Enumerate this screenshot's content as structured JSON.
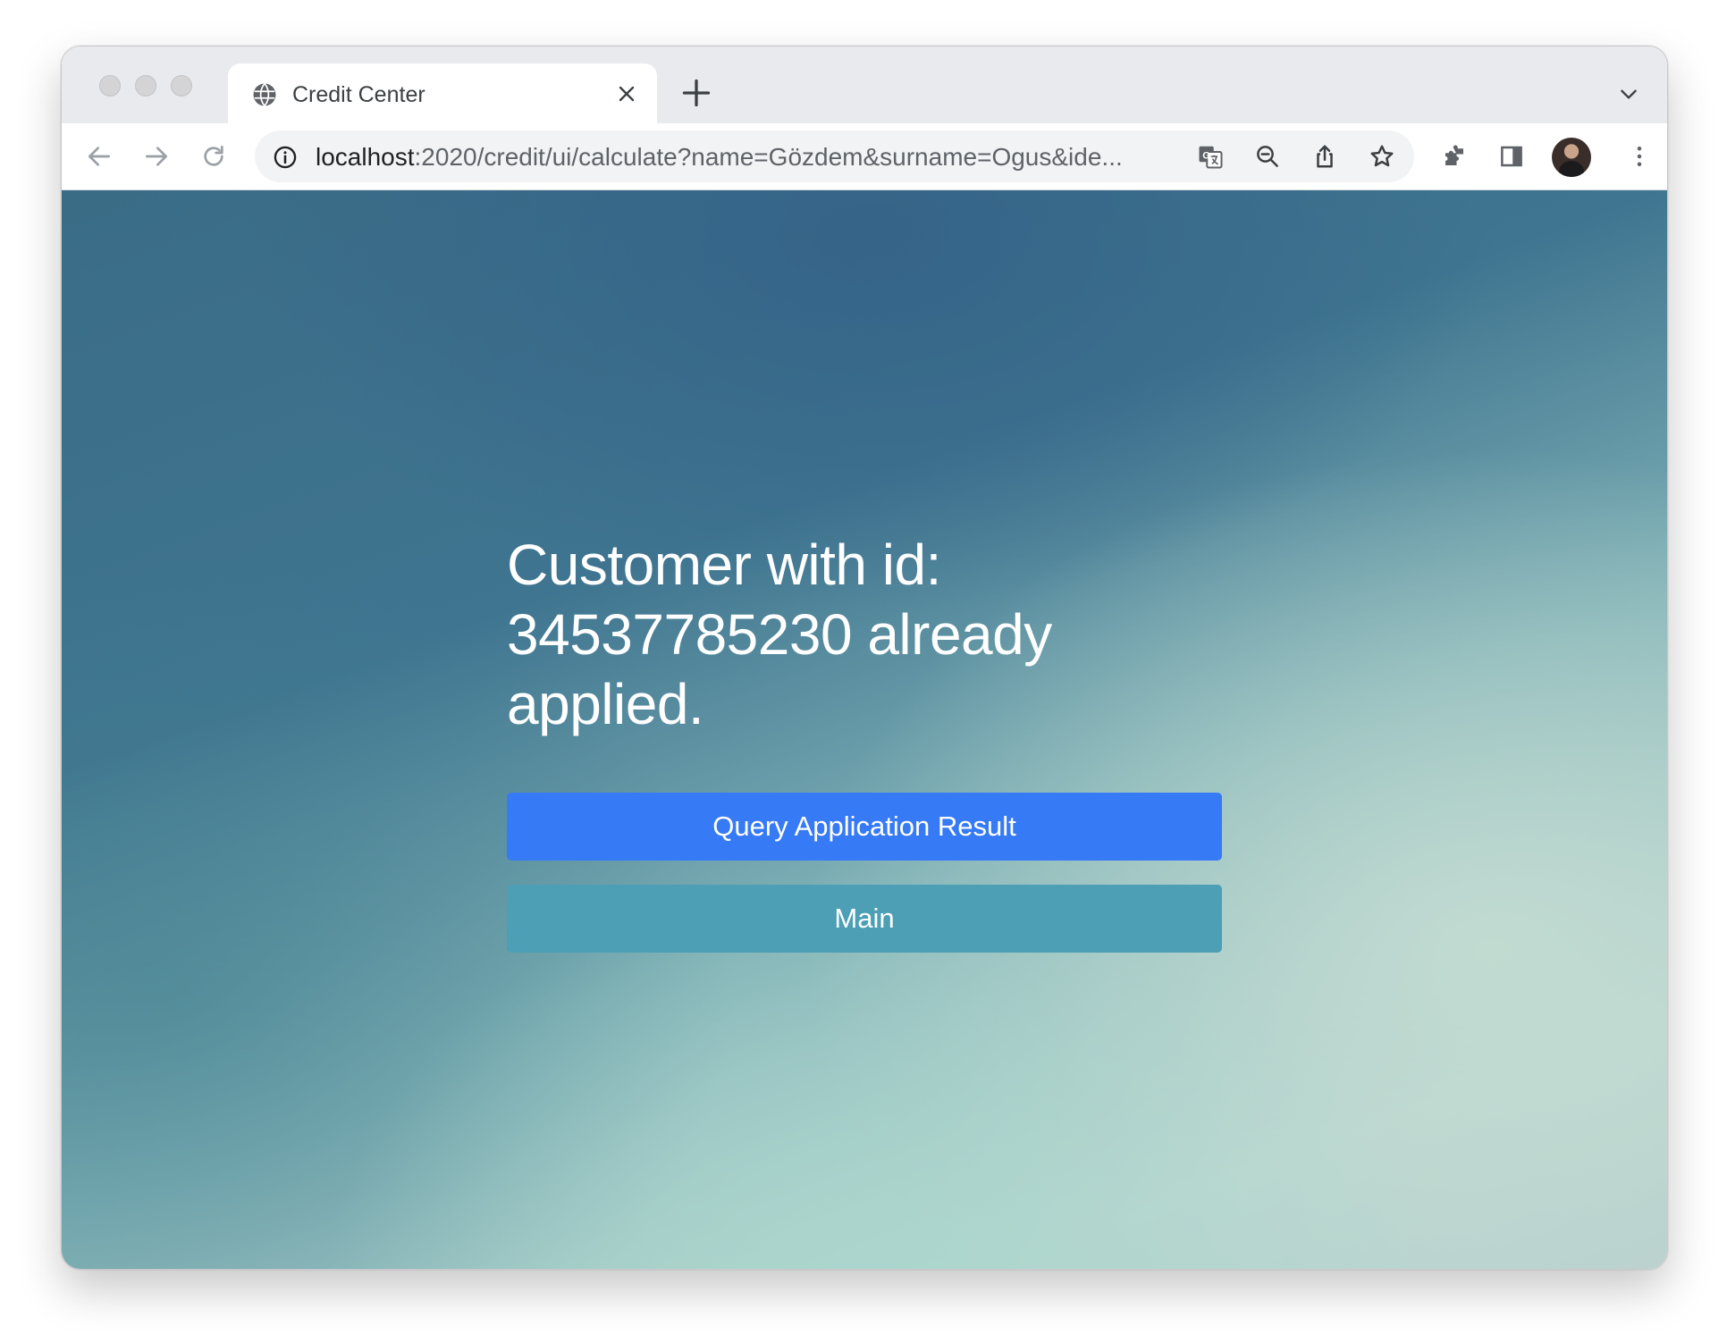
{
  "browser": {
    "tab": {
      "title": "Credit Center"
    },
    "address_bar": {
      "host": "localhost",
      "path": ":2020/credit/ui/calculate?name=Gözdem&surname=Ogus&ide..."
    },
    "icons": {
      "back": "back-arrow-icon",
      "forward": "forward-arrow-icon",
      "reload": "reload-icon",
      "site_info": "info-icon",
      "translate": "translate-icon",
      "zoom": "zoom-out-icon",
      "share": "share-icon",
      "bookmark": "star-icon",
      "extensions": "puzzle-icon",
      "side_panel": "side-panel-icon",
      "menu": "kebab-menu-icon"
    }
  },
  "page": {
    "message": "Customer with id: 34537785230 already applied.",
    "buttons": {
      "query_label": "Query Application Result",
      "main_label": "Main"
    }
  },
  "colors": {
    "primary_button": "#377af5",
    "info_button": "#4c9fb4",
    "background_dark": "#3a6c86",
    "background_light": "#b9d5d0"
  }
}
